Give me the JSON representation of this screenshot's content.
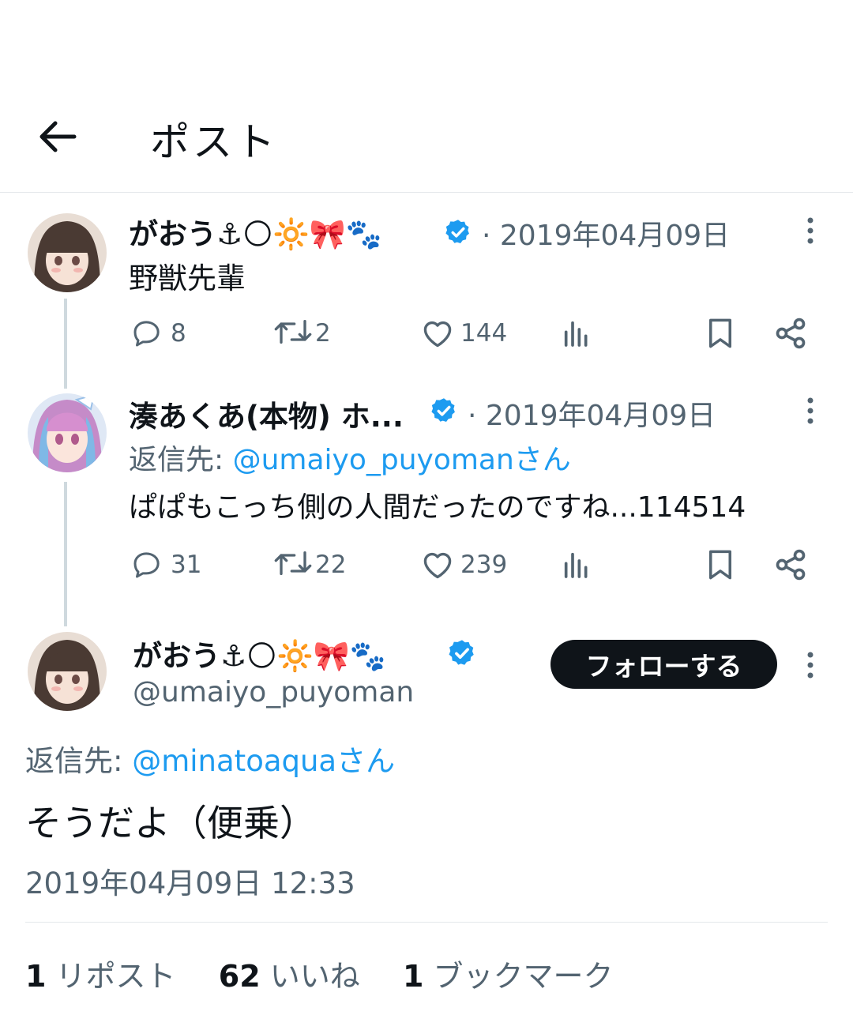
{
  "header": {
    "title": "ポスト"
  },
  "tweets": [
    {
      "author": "がおう⚓🌕🔆🎀🐾",
      "date": "· 2019年04月09日",
      "text": "野獣先輩",
      "replies": "8",
      "reposts": "2",
      "likes": "144"
    },
    {
      "author": "湊あくあ(本物) ホ...",
      "date": "· 2019年04月09日",
      "reply_to_label": "返信先: ",
      "reply_to": "@umaiyo_puyomanさん",
      "text": "ぱぱもこっち側の人間だったのですね...114514",
      "replies": "31",
      "reposts": "22",
      "likes": "239"
    }
  ],
  "main": {
    "author": "がおう⚓🌕🔆🎀🐾",
    "handle": "@umaiyo_puyoman",
    "follow_label": "フォローする",
    "reply_to_label": "返信先: ",
    "reply_to": "@minatoaquaさん",
    "text": "そうだよ（便乗）",
    "timestamp": "2019年04月09日 12:33",
    "stats": {
      "reposts_num": "1",
      "reposts_label": "リポスト",
      "likes_num": "62",
      "likes_label": "いいね",
      "bookmarks_num": "1",
      "bookmarks_label": "ブックマーク"
    }
  },
  "colors": {
    "accent": "#1d9bf0",
    "muted": "#536471",
    "text": "#0f1419"
  }
}
